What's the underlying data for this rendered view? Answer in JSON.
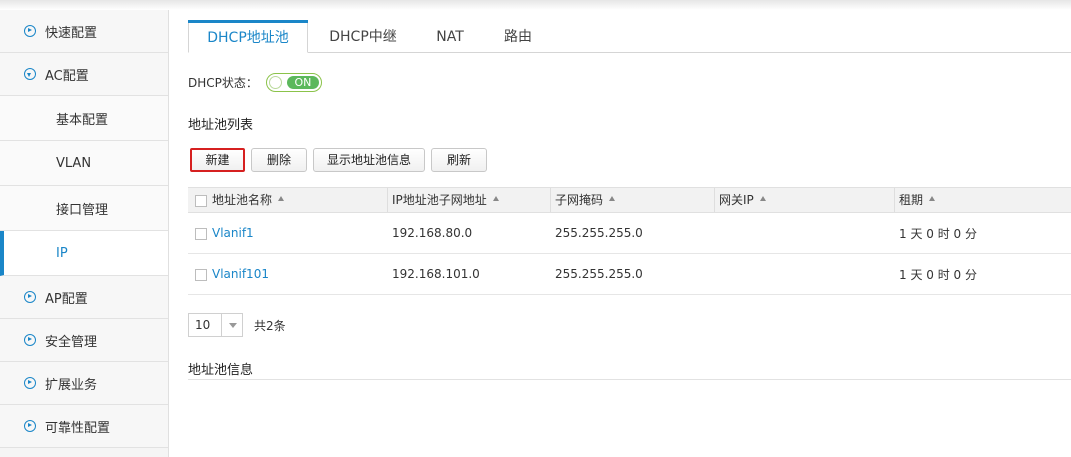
{
  "sidebar": {
    "quick_config": "快速配置",
    "ac_config": "AC配置",
    "sub": {
      "basic": "基本配置",
      "vlan": "VLAN",
      "interface": "接口管理",
      "ip": "IP"
    },
    "ap_config": "AP配置",
    "security": "安全管理",
    "extended": "扩展业务",
    "reliability": "可靠性配置"
  },
  "tabs": [
    "DHCP地址池",
    "DHCP中继",
    "NAT",
    "路由"
  ],
  "dhcp_state": {
    "label": "DHCP状态：",
    "toggle": "ON"
  },
  "pool_list_title": "地址池列表",
  "buttons": {
    "new": "新建",
    "delete": "删除",
    "show_info": "显示地址池信息",
    "refresh": "刷新"
  },
  "table": {
    "headers": [
      "地址池名称",
      "IP地址池子网地址",
      "子网掩码",
      "网关IP",
      "租期"
    ],
    "rows": [
      {
        "name": "Vlanif1",
        "subnet": "192.168.80.0",
        "mask": "255.255.255.0",
        "gateway": "",
        "lease": "1 天 0 时 0 分"
      },
      {
        "name": "Vlanif101",
        "subnet": "192.168.101.0",
        "mask": "255.255.255.0",
        "gateway": "",
        "lease": "1 天 0 时 0 分"
      }
    ]
  },
  "pager": {
    "page_size": "10",
    "total": "共2条"
  },
  "pool_info_title": "地址池信息",
  "colors": {
    "accent": "#1a86c8",
    "toggle_on": "#5cb85c",
    "highlight": "#d62020"
  }
}
